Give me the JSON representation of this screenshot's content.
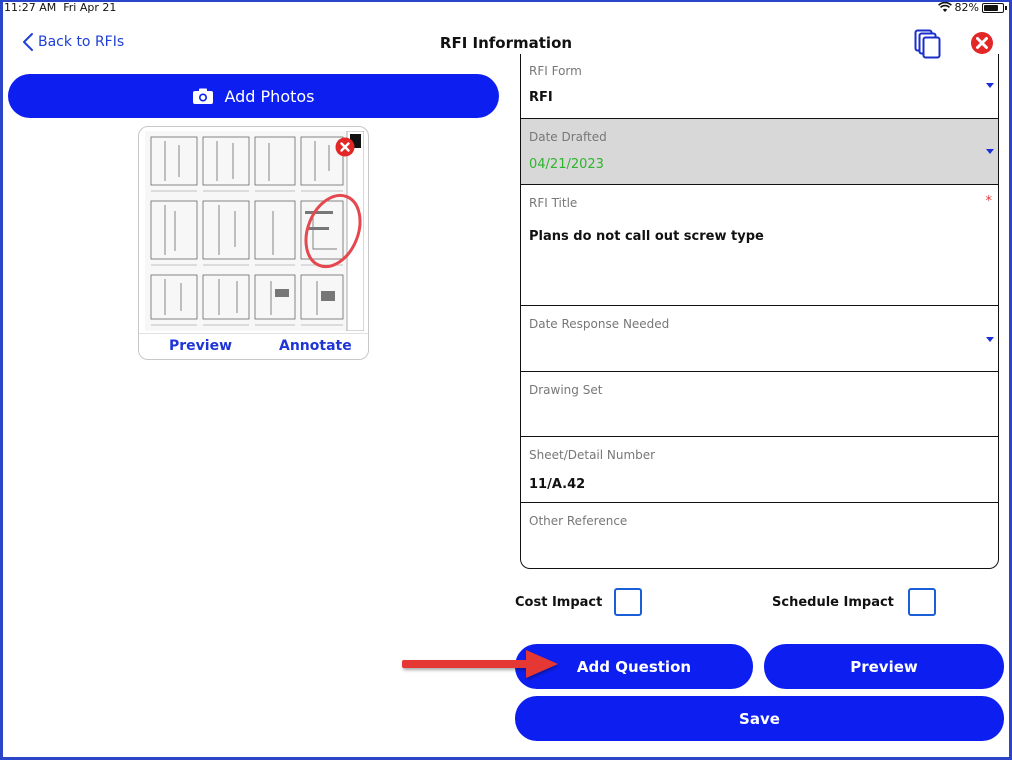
{
  "status_bar": {
    "time": "11:27 AM",
    "date": "Fri Apr 21",
    "battery": "82%"
  },
  "nav": {
    "back_label": "Back to RFIs",
    "title": "RFI Information"
  },
  "photos": {
    "add_label": "Add Photos",
    "preview_label": "Preview",
    "annotate_label": "Annotate"
  },
  "form": {
    "rfi_form": {
      "label": "RFI Form",
      "value": "RFI"
    },
    "date_drafted": {
      "label": "Date Drafted",
      "value": "04/21/2023",
      "value_color": "#2db52d"
    },
    "rfi_title": {
      "label": "RFI Title",
      "value": "Plans do not call out screw type",
      "required_mark": "*"
    },
    "date_response_needed": {
      "label": "Date Response Needed",
      "value": ""
    },
    "drawing_set": {
      "label": "Drawing Set",
      "value": ""
    },
    "sheet_detail_number": {
      "label": "Sheet/Detail Number",
      "value": "11/A.42"
    },
    "other_reference": {
      "label": "Other Reference",
      "value": ""
    }
  },
  "impacts": {
    "cost_label": "Cost Impact",
    "cost_checked": false,
    "schedule_label": "Schedule Impact",
    "schedule_checked": false
  },
  "buttons": {
    "add_question": "Add Question",
    "preview": "Preview",
    "save": "Save"
  },
  "colors": {
    "primary": "#0d1ff0",
    "link": "#1f3fd6",
    "close": "#e32626",
    "annotation_arrow": "#e53935"
  }
}
